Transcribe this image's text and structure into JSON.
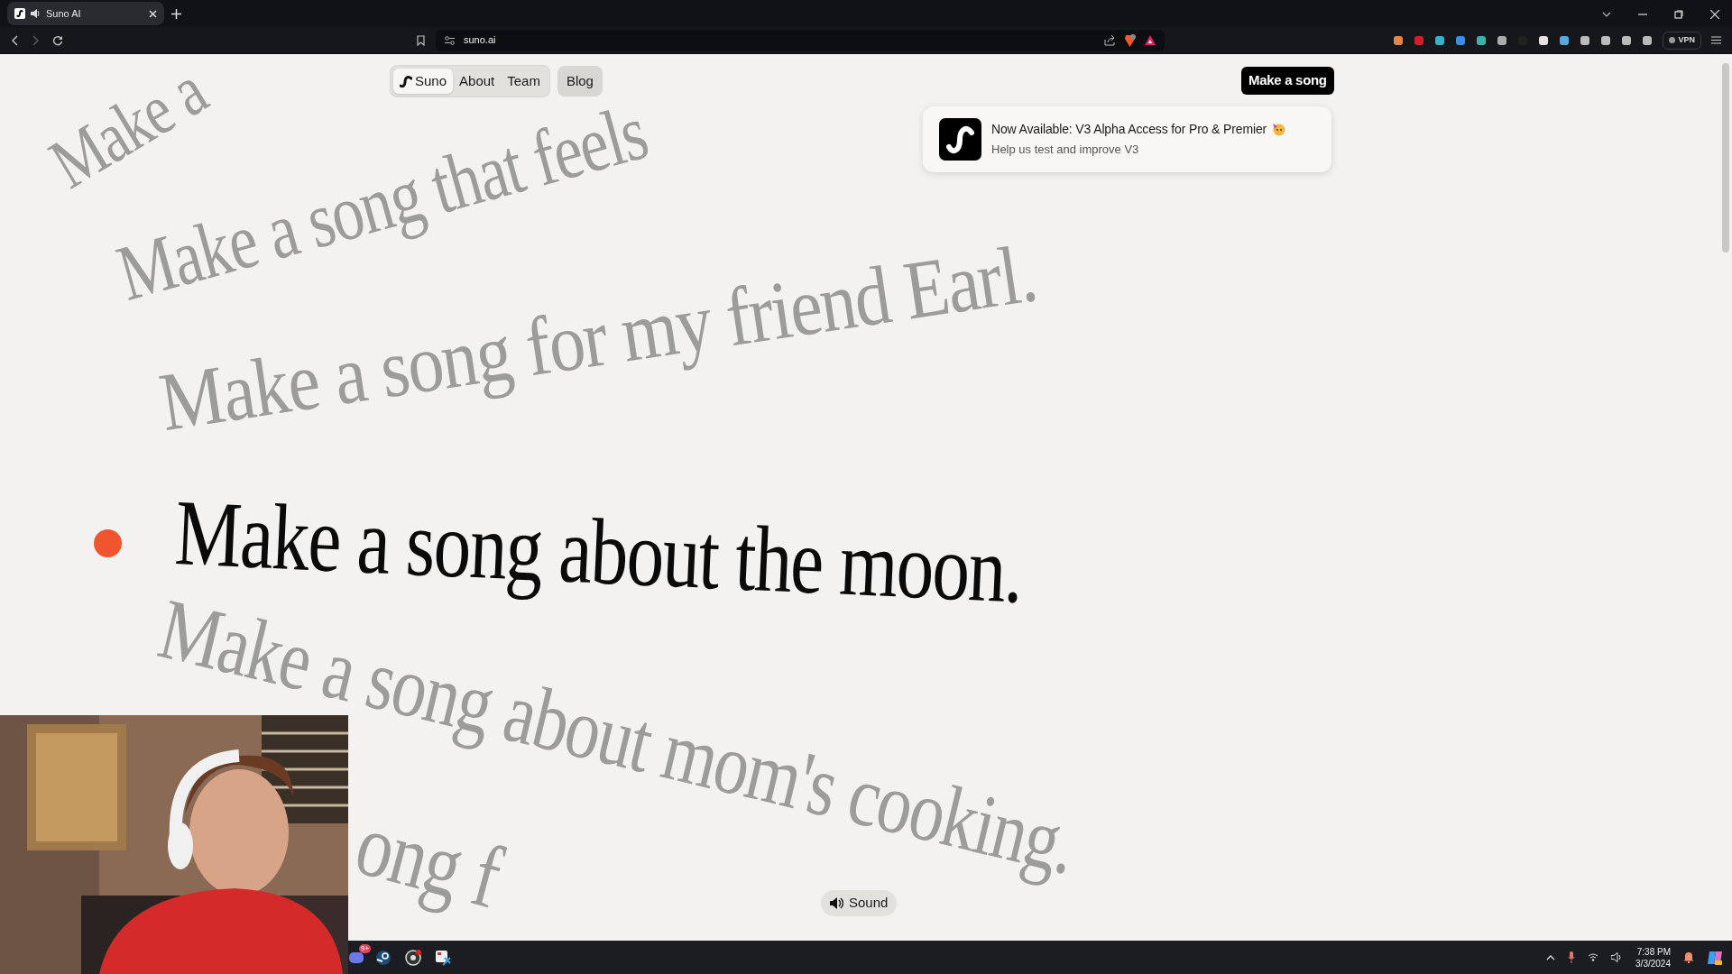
{
  "browser": {
    "tab": {
      "title": "Suno AI",
      "playing": true
    },
    "url": "suno.ai",
    "vpn_label": "VPN"
  },
  "nav": {
    "items": [
      {
        "label": "Suno",
        "selected": true
      },
      {
        "label": "About",
        "selected": false
      },
      {
        "label": "Team",
        "selected": false
      }
    ],
    "blog": "Blog",
    "cta": "Make a song"
  },
  "notice": {
    "title": "Now Available: V3 Alpha Access for Pro & Premier",
    "subtitle": "Help us test and improve V3"
  },
  "prompts": [
    {
      "text": "Make a",
      "active": false
    },
    {
      "text": "Make a song that feels",
      "active": false
    },
    {
      "text": "Make a song for my friend Earl.",
      "active": false
    },
    {
      "text": "Make a song about the moon.",
      "active": true
    },
    {
      "text": "Make a song about mom's cooking.",
      "active": false
    },
    {
      "text": "ong f",
      "active": false
    }
  ],
  "sound_button": "Sound",
  "taskbar": {
    "badge": "9+",
    "time": "7:38 PM",
    "date": "3/3/2024"
  }
}
